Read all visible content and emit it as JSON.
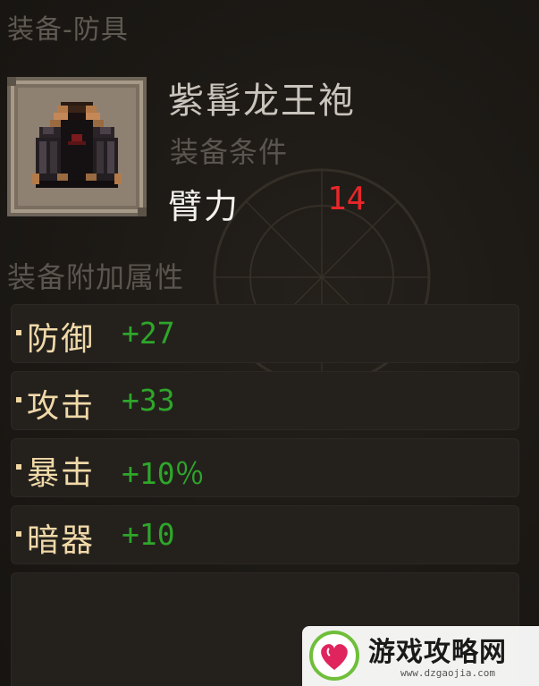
{
  "header": {
    "category": "装备-防具"
  },
  "item": {
    "name": "紫髯龙王袍",
    "icon": "dark-robe-icon",
    "requirement_label": "装备条件",
    "requirement_stat": "臂力",
    "requirement_value": "14"
  },
  "attributes": {
    "title": "装备附加属性",
    "rows": [
      {
        "name": "防御",
        "value": "+27"
      },
      {
        "name": "攻击",
        "value": "+33"
      },
      {
        "name": "暴击",
        "value": "+10％"
      },
      {
        "name": "暗器",
        "value": "+10"
      }
    ]
  },
  "colors": {
    "attr_name": "#f0d9a8",
    "attr_value": "#2ea62a",
    "requirement_value": "#e8262a"
  },
  "watermark": {
    "text": "游戏攻略网",
    "url": "www.dzgaojia.com",
    "logo": "heart-logo-icon"
  }
}
